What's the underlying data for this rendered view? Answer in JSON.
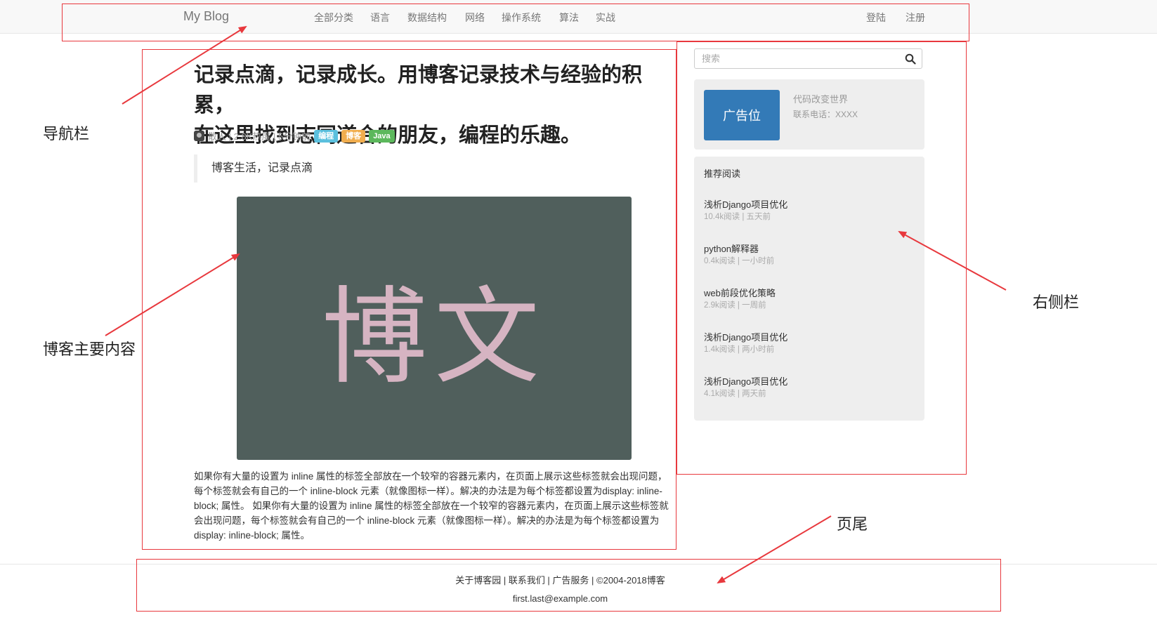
{
  "navbar": {
    "brand": "My Blog",
    "items": [
      "全部分类",
      "语言",
      "数据结构",
      "网络",
      "操作系统",
      "算法",
      "实战"
    ],
    "login": "登陆",
    "register": "注册"
  },
  "post": {
    "title_line1": "记录点滴，记录成长。用博客记录技术与经验的积累，",
    "title_line2": "在这里找到志同道合的朋友，编程的乐趣。",
    "meta": "散人 | 2.8K热度 | 5分钟前",
    "tags": [
      {
        "label": "编程",
        "color": "#5bc0de"
      },
      {
        "label": "博客",
        "color": "#f0ad4e"
      },
      {
        "label": "Java",
        "color": "#5cb85c"
      }
    ],
    "quote": "博客生活，记录点滴",
    "image_text": "博文",
    "body": "如果你有大量的设置为 inline 属性的标签全部放在一个较窄的容器元素内，在页面上展示这些标签就会出现问题，每个标签就会有自己的一个 inline-block 元素（就像图标一样）。解决的办法是为每个标签都设置为display: inline-block; 属性。 如果你有大量的设置为 inline 属性的标签全部放在一个较窄的容器元素内，在页面上展示这些标签就会出现问题，每个标签就会有自己的一个 inline-block 元素（就像图标一样）。解决的办法是为每个标签都设置为 display: inline-block; 属性。"
  },
  "sidebar": {
    "search_placeholder": "搜索",
    "ad": {
      "box_label": "广告位",
      "title": "代码改变世界",
      "phone": "联系电话：XXXX"
    },
    "recommended": {
      "heading": "推荐阅读",
      "items": [
        {
          "title": "浅析Django项目优化",
          "meta": "10.4k阅读 | 五天前"
        },
        {
          "title": "python解释器",
          "meta": "0.4k阅读 | 一小时前"
        },
        {
          "title": "web前段优化策略",
          "meta": "2.9k阅读 | 一周前"
        },
        {
          "title": "浅析Django项目优化",
          "meta": "1.4k阅读 | 两小时前"
        },
        {
          "title": "浅析Django项目优化",
          "meta": "4.1k阅读 | 两天前"
        }
      ]
    }
  },
  "footer": {
    "links": "关于博客园 | 联系我们 | 广告服务 | ©2004-2018博客",
    "email": "first.last@example.com"
  },
  "annotations": {
    "color": "#e8383d",
    "navbar": "导航栏",
    "main": "博客主要内容",
    "sidebar": "右侧栏",
    "footer": "页尾"
  }
}
